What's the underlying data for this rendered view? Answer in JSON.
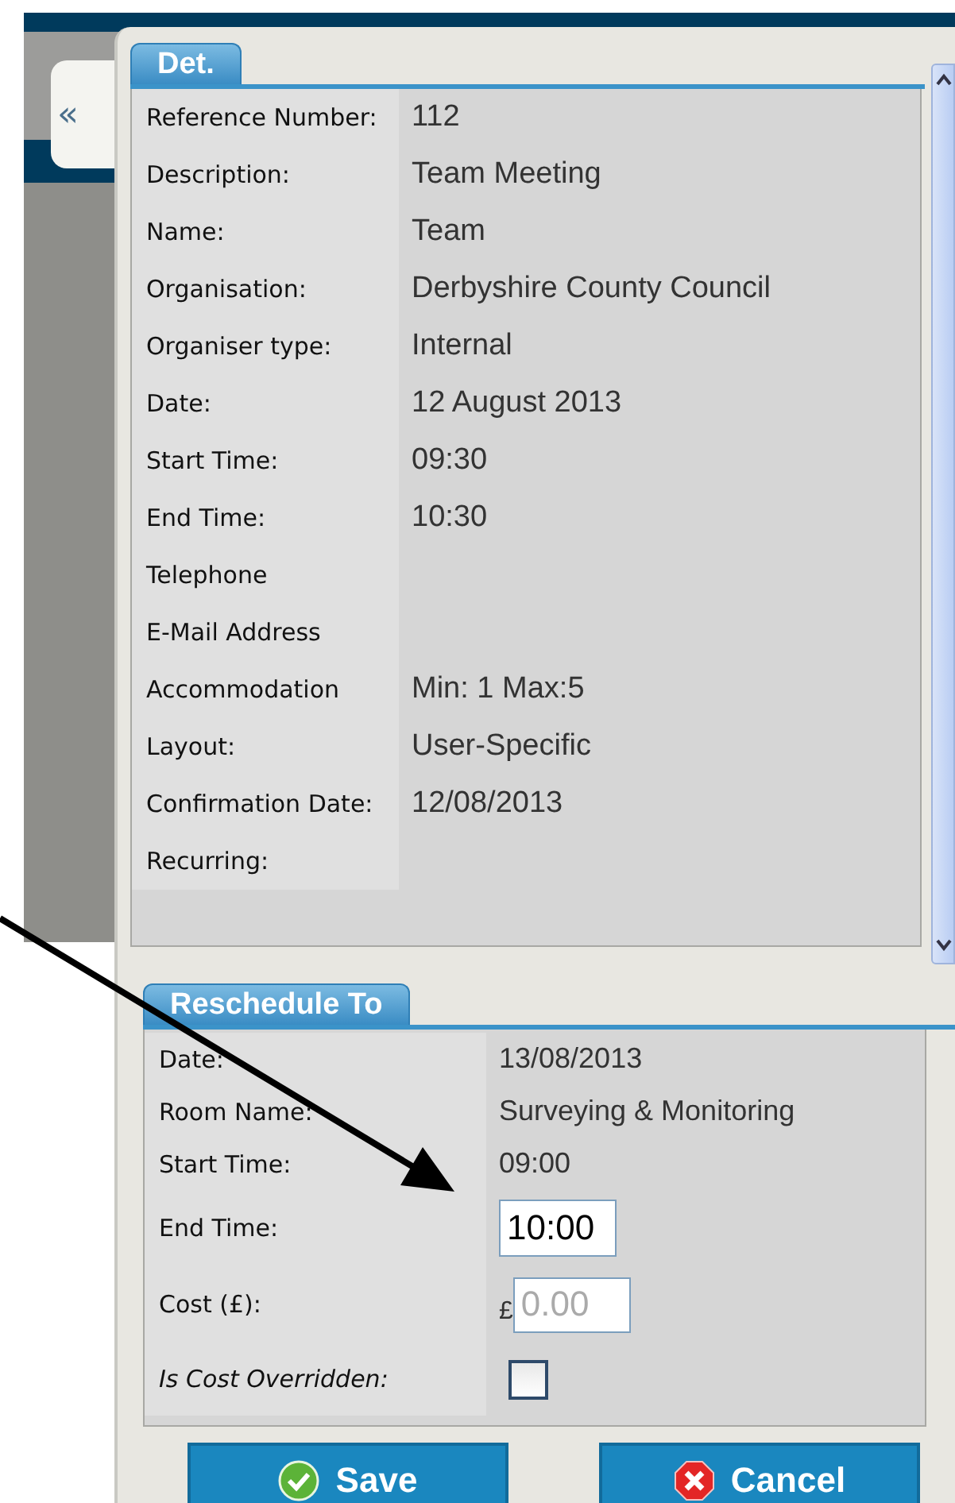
{
  "collapse_button": {
    "label": "«"
  },
  "details_tab": {
    "label": "Det.",
    "selected": true
  },
  "details": [
    {
      "label": "Reference Number:",
      "value": "112"
    },
    {
      "label": "Description:",
      "value": "Team Meeting"
    },
    {
      "label": "Name:",
      "value": "Team"
    },
    {
      "label": "Organisation:",
      "value": "Derbyshire County Council"
    },
    {
      "label": "Organiser type:",
      "value": "Internal"
    },
    {
      "label": "Date:",
      "value": "12 August 2013"
    },
    {
      "label": "Start Time:",
      "value": "09:30"
    },
    {
      "label": "End Time:",
      "value": "10:30"
    },
    {
      "label": "Telephone"
    },
    {
      "label": "E-Mail Address"
    },
    {
      "label": "Accommodation",
      "value": "Min: 1  Max:5"
    },
    {
      "label": "Layout:",
      "value": "User-Specific"
    },
    {
      "label": "Confirmation Date:",
      "value": "12/08/2013"
    },
    {
      "label": "Recurring:"
    }
  ],
  "reschedule_tab": {
    "label": "Reschedule To",
    "selected": true
  },
  "reschedule": [
    {
      "kind": "text",
      "label": "Date:",
      "value": "13/08/2013"
    },
    {
      "kind": "text",
      "label": "Room Name:",
      "value": "Surveying & Monitoring"
    },
    {
      "kind": "text",
      "label": "Start Time:",
      "value": "09:00"
    },
    {
      "kind": "input",
      "label": "End Time:",
      "value": "10:00"
    },
    {
      "kind": "currency",
      "label": "Cost (£):",
      "prefix": "£",
      "placeholder": "0.00"
    },
    {
      "kind": "checkbox",
      "label": "Is Cost Overridden:",
      "checked": false
    }
  ],
  "buttons": [
    {
      "kind": "save",
      "label": "Save"
    },
    {
      "kind": "cancel",
      "label": "Cancel"
    }
  ]
}
